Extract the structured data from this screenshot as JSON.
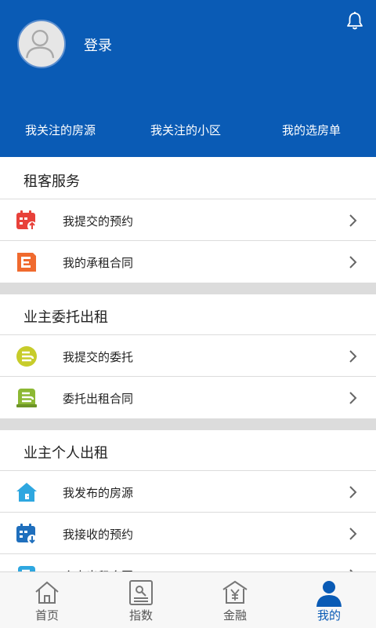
{
  "header": {
    "login_label": "登录",
    "favorites": [
      "我关注的房源",
      "我关注的小区",
      "我的选房单"
    ],
    "bg_color": "#0a5bb5"
  },
  "sections": [
    {
      "title": "租客服务",
      "items": [
        {
          "label": "我提交的预约",
          "icon": "calendar-upload-icon",
          "color": "#e8413a"
        },
        {
          "label": "我的承租合同",
          "icon": "contract-icon",
          "color": "#f06a2e"
        }
      ]
    },
    {
      "title": "业主委托出租",
      "items": [
        {
          "label": "我提交的委托",
          "icon": "entrust-icon",
          "color": "#c7cc2a"
        },
        {
          "label": "委托出租合同",
          "icon": "entrust-contract-icon",
          "color": "#8cb833"
        }
      ]
    },
    {
      "title": "业主个人出租",
      "items": [
        {
          "label": "我发布的房源",
          "icon": "house-icon",
          "color": "#2ea7e0"
        },
        {
          "label": "我接收的预约",
          "icon": "calendar-download-icon",
          "color": "#1f6fbd"
        },
        {
          "label": "个人出租合同",
          "icon": "personal-contract-icon",
          "color": "#2ea7e0"
        }
      ]
    }
  ],
  "tabs": [
    {
      "label": "首页",
      "icon": "home-icon"
    },
    {
      "label": "指数",
      "icon": "index-icon"
    },
    {
      "label": "金融",
      "icon": "finance-icon"
    },
    {
      "label": "我的",
      "icon": "profile-icon",
      "active": true
    }
  ]
}
